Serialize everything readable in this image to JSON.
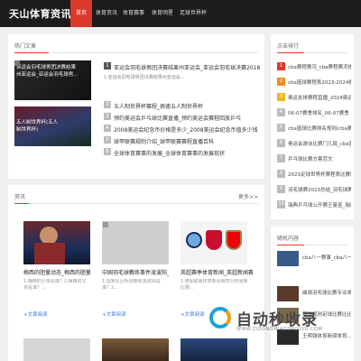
{
  "site": {
    "title": "天山体育资讯网"
  },
  "nav": [
    "首页",
    "体育资讯",
    "体育赛事",
    "体育明星",
    "足球世界杯"
  ],
  "hot": {
    "title": "热门文章",
    "featured": [
      {
        "caption": "亚运会羽毛球男团决赛结果",
        "sub": "州亚运会_亚运会羽毛球男..."
      },
      {
        "caption": "五人制世界杯(五人",
        "sub": "制世界杯)"
      }
    ],
    "list": [
      {
        "num": "1",
        "title": "亚运会羽毛球男团决赛结果州亚运会_亚运会羽毛球决赛2018",
        "desc": "1.亚运会羽毛球男团决赛结果州亚运会..."
      },
      {
        "num": "2",
        "title": "五人制世界杯赛程_佩德五人制世界杯"
      },
      {
        "num": "3",
        "title": "预约美运会乒乓球比赛直播_预约美运会赛程回放乒乓"
      },
      {
        "num": "4",
        "title": "2008美运会纪念币价格是多少_2008美运会纪念币值多少钱"
      },
      {
        "num": "5",
        "title": "球甲联赛规则介绍_球甲联赛赛程直播百科"
      },
      {
        "num": "6",
        "title": "全球体育赛事的发展_全球体育赛事的发展现状"
      }
    ]
  },
  "news": {
    "title": "资讯",
    "more": "更多>>",
    "cards": [
      {
        "title": "梅西的胆量动态_梅西的胆量动态比...",
        "desc": "1.梅西的父亲是谁？2.梅西的父亲是谁？...",
        "more": "+文章阅读"
      },
      {
        "title": "中国羽毛球教练事件凌波阳_羽毛...",
        "desc": "1.国家队羽毛球教练凌波阳是谁？2...",
        "more": "+文章阅读"
      },
      {
        "title": "英超赛季体育新闻_英超新闻赛...",
        "desc": "1.英超联赛体育新闻赛季分析最新比赛...",
        "more": "+文章阅读"
      }
    ]
  },
  "rank": {
    "title": "点击排行",
    "items": [
      "cba赛程赛况_cba赛程赛况体育赛",
      "cba篮球赛程表2023-2024赛季",
      "奥运女排赛程直播_2024奥运女排",
      "06-07赛季排名_06-07赛季",
      "cba篮球比赛排名规则(cba赛...",
      "奥运会游泳比赛门几局_cba篮球",
      "乒乓球比赛方案范文",
      "2023足球世界杯赛程表比赛时间表",
      "羽毛球赛2023总结_羽毛球赛",
      "瑞典乒乓球公开赛王曼昱_瑞典"
    ],
    "colors": [
      "#dc3a2c",
      "#f08a24",
      "#f0b424",
      "#bbbbbb",
      "#bbbbbb",
      "#bbbbbb",
      "#bbbbbb",
      "#bbbbbb",
      "#bbbbbb",
      "#bbbbbb"
    ]
  },
  "random": {
    "title": "随机内容",
    "items": [
      "cba八一赛事_cba八一赛事直播",
      "曲靖羽毛球比赛专业体育...",
      "篮球规则足球比赛比比...",
      "王明强体育新闻体育..."
    ]
  },
  "watermark": {
    "main": "自动秒收录",
    "sub": "WWW.ZIDONGMIAOSHOULU.COM"
  }
}
